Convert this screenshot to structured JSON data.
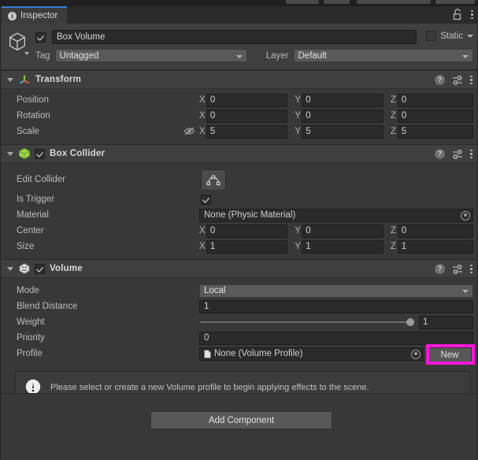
{
  "window": {
    "tab_label": "Inspector",
    "tab_icon": "info-icon",
    "lock_icon": "lock-open-icon",
    "menu_icon": "kebab-menu-icon"
  },
  "object_header": {
    "icon": "cube-icon",
    "enabled": true,
    "name": "Box Volume",
    "static_label": "Static",
    "static_checked": false,
    "tag_label": "Tag",
    "tag_value": "Untagged",
    "layer_label": "Layer",
    "layer_value": "Default"
  },
  "components": [
    {
      "name": "Transform",
      "icon": "transform-axes-icon",
      "has_checkbox": false,
      "rows": [
        {
          "label": "Position",
          "type": "vector3",
          "x": "0",
          "y": "0",
          "z": "0"
        },
        {
          "label": "Rotation",
          "type": "vector3",
          "x": "0",
          "y": "0",
          "z": "0"
        },
        {
          "label": "Scale",
          "type": "vector3",
          "x": "5",
          "y": "5",
          "z": "5",
          "prefix_icon": "constrain-proportions-off-icon"
        }
      ]
    },
    {
      "name": "Box Collider",
      "icon": "box-collider-icon",
      "has_checkbox": true,
      "enabled": true,
      "rows": [
        {
          "label": "Edit Collider",
          "type": "button",
          "icon": "edit-collider-icon"
        },
        {
          "label": "Is Trigger",
          "type": "checkbox",
          "checked": true
        },
        {
          "label": "Material",
          "type": "object",
          "value": "None (Physic Material)"
        },
        {
          "label": "Center",
          "type": "vector3",
          "x": "0",
          "y": "0",
          "z": "0"
        },
        {
          "label": "Size",
          "type": "vector3",
          "x": "1",
          "y": "1",
          "z": "1"
        }
      ]
    },
    {
      "name": "Volume",
      "icon": "volume-icon",
      "has_checkbox": true,
      "enabled": true,
      "rows": [
        {
          "label": "Mode",
          "type": "dropdown",
          "value": "Local"
        },
        {
          "label": "Blend Distance",
          "type": "text",
          "value": "1"
        },
        {
          "label": "Weight",
          "type": "slider",
          "value": "1",
          "fill": 100
        },
        {
          "label": "Priority",
          "type": "text",
          "value": "0"
        },
        {
          "label": "Profile",
          "type": "object-with-button",
          "value": "None (Volume Profile)",
          "file_icon": "file-icon",
          "button_label": "New",
          "highlighted": true
        }
      ]
    }
  ],
  "help_box": {
    "icon": "warning-icon",
    "message": "Please select or create a new Volume profile to begin applying effects to the scene."
  },
  "footer": {
    "add_component_label": "Add Component"
  },
  "header_icons": {
    "help": "help-icon",
    "preset": "preset-icon",
    "menu": "kebab-menu-icon"
  },
  "colors": {
    "background": "#383838",
    "panel": "#3f3f3f",
    "field": "#2a2a2a",
    "accent_tab": "#3d7bd4",
    "highlight": "#f717d6",
    "collider_green": "#9bd64a"
  }
}
